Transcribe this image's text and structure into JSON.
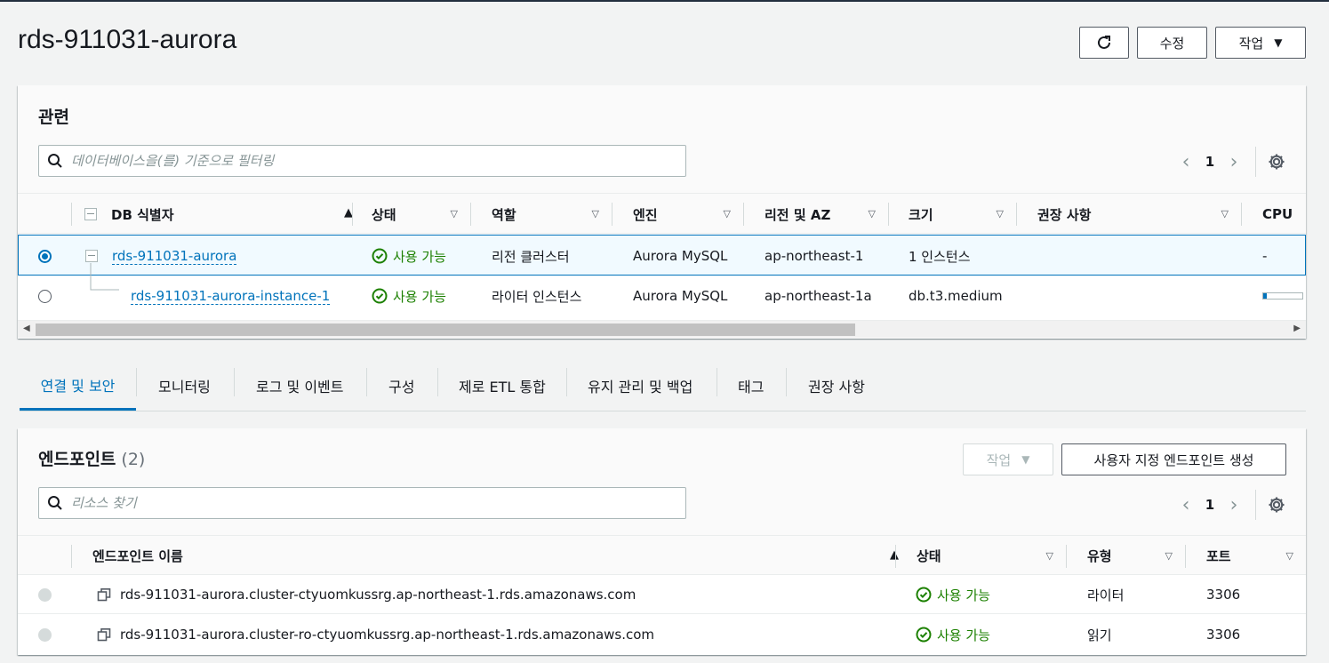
{
  "page": {
    "title": "rds-911031-aurora"
  },
  "header_buttons": {
    "edit": "수정",
    "actions": "작업"
  },
  "related": {
    "title": "관련",
    "search_placeholder": "데이터베이스을(를) 기준으로 필터링",
    "page": "1",
    "columns": [
      "DB 식별자",
      "상태",
      "역할",
      "엔진",
      "리전 및 AZ",
      "크기",
      "권장 사항",
      "CPU"
    ],
    "rows": [
      {
        "id": "rds-911031-aurora",
        "status": "사용 가능",
        "role": "리전 클러스터",
        "engine": "Aurora MySQL",
        "region": "ap-northeast-1",
        "size": "1 인스턴스",
        "recommend": "",
        "cpu": "-",
        "selected": true
      },
      {
        "id": "rds-911031-aurora-instance-1",
        "status": "사용 가능",
        "role": "라이터 인스턴스",
        "engine": "Aurora MySQL",
        "region": "ap-northeast-1a",
        "size": "db.t3.medium",
        "recommend": "",
        "cpu_fraction": 0.1,
        "selected": false
      }
    ]
  },
  "tabs": [
    "연결 및 보안",
    "모니터링",
    "로그 및 이벤트",
    "구성",
    "제로 ETL 통합",
    "유지 관리 및 백업",
    "태그",
    "권장 사항"
  ],
  "endpoints": {
    "title": "엔드포인트",
    "count": "(2)",
    "actions_label": "작업",
    "create_label": "사용자 지정 엔드포인트 생성",
    "search_placeholder": "리소스 찾기",
    "page": "1",
    "columns": [
      "엔드포인트 이름",
      "상태",
      "유형",
      "포트"
    ],
    "rows": [
      {
        "name": "rds-911031-aurora.cluster-ctyuomkussrg.ap-northeast-1.rds.amazonaws.com",
        "status": "사용 가능",
        "type": "라이터",
        "port": "3306"
      },
      {
        "name": "rds-911031-aurora.cluster-ro-ctyuomkussrg.ap-northeast-1.rds.amazonaws.com",
        "status": "사용 가능",
        "type": "읽기",
        "port": "3306"
      }
    ]
  },
  "colors": {
    "accent": "#0073bb",
    "success": "#1d8102",
    "text": "#16191f"
  }
}
